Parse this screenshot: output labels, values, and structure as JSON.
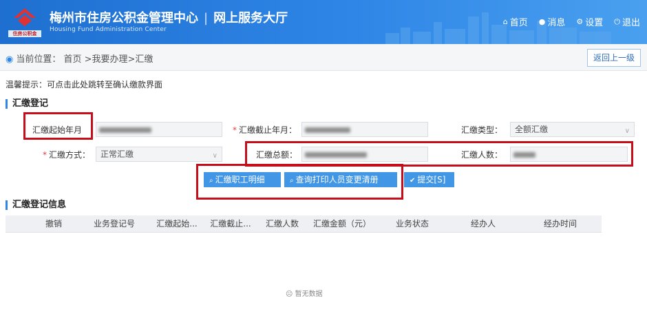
{
  "header": {
    "title": "梅州市住房公积金管理中心",
    "subtitle": "网上服务大厅",
    "english": "Housing Fund Administration Center",
    "logo_text": "住房公积金",
    "nav": [
      {
        "label": "首页",
        "icon": "home-icon"
      },
      {
        "label": "消息",
        "icon": "message-icon"
      },
      {
        "label": "设置",
        "icon": "gear-icon"
      },
      {
        "label": "退出",
        "icon": "power-icon"
      }
    ]
  },
  "breadcrumb": {
    "prefix": "当前位置：",
    "path": "首页 >我要办理>汇缴",
    "back_label": "返回上一级"
  },
  "tip": "温馨提示：可点击此处跳转至确认缴款界面",
  "register": {
    "section_title": "汇缴登记",
    "start_label": "汇缴起始年月",
    "end_label": "汇缴截止年月：",
    "type_label": "汇缴类型：",
    "type_value": "全额汇缴",
    "method_label": "汇缴方式：",
    "method_value": "正常汇缴",
    "total_label": "汇缴总额：",
    "count_label": "汇缴人数："
  },
  "buttons": {
    "detail": "汇缴职工明细",
    "print_changes": "查询打印人员变更清册",
    "submit": "提交[S]"
  },
  "info": {
    "section_title": "汇缴登记信息",
    "columns": [
      "撤销",
      "业务登记号",
      "汇缴起始...",
      "汇缴截止...",
      "汇缴人数",
      "汇缴金额（元）",
      "业务状态",
      "经办人",
      "经办时间"
    ],
    "empty_text": "暂无数据"
  },
  "colors": {
    "header": "#2f86e6",
    "accent": "#4296e6",
    "highlight": "#c40f1b"
  }
}
